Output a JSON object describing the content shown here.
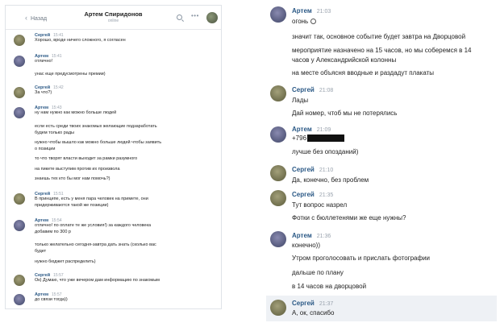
{
  "left": {
    "header": {
      "back": "Назад",
      "title": "Артем Спиридонов",
      "subtitle": "online"
    },
    "messages": [
      {
        "name": "Сергей",
        "time": "15:41",
        "lines": [
          "Хорошо, вроде ничего сложного, я согласен"
        ]
      },
      {
        "name": "Артем",
        "time": "15:41",
        "lines": [
          "отлично!"
        ]
      },
      {
        "name": "Сергей",
        "time": "15:42",
        "lines": [
          "За что?)"
        ]
      },
      {
        "name": "Артем",
        "time": "15:43",
        "lines": [
          "ну нам нужно как можно больше людей"
        ]
      },
      {
        "name": "Сергей",
        "time": "15:51",
        "lines": [
          "В принципе, есть у меня пара человек на примете, они",
          "придерживаются такой же позиции)"
        ]
      },
      {
        "name": "Артем",
        "time": "15:54",
        "lines": [
          "отлично! по оплате те же условия!) за каждого человека",
          "добавим по 300 р"
        ]
      },
      {
        "name": "Сергей",
        "time": "15:57",
        "lines": [
          "Ок) Думаю, что уже вечером дам информацию по знакомым"
        ]
      },
      {
        "name": "Артем",
        "time": "15:57",
        "lines": [
          "до связи тогда))"
        ]
      }
    ],
    "extra_lines": [
      "унас еще предусмотрены премии)",
      "если есть среди твоих знакомых желающие подзаработать",
      "будем только рады",
      "нужно чтобы вышло как можно больше людей чтобы заявить",
      "о позиции",
      "то что творят власти выходит за рамки разумного",
      "на пикете выступим против их произвола",
      "знаешь тех кто бы мог нам помочь?)",
      "только желательно сегодня-завтра дать знать (сколько вас",
      "будет",
      "нужно бюджет распределить)"
    ]
  },
  "right": {
    "messages": [
      {
        "name": "Артем",
        "time": "21:03",
        "lines": [
          "огонь"
        ]
      },
      {
        "name": "Сергей",
        "time": "21:08",
        "lines": [
          "Лады"
        ]
      },
      {
        "name": "Артем",
        "time": "21:09",
        "lines": [
          "+796"
        ]
      },
      {
        "name": "Сергей",
        "time": "21:10",
        "lines": [
          "Да, конечно, без проблем"
        ]
      },
      {
        "name": "Сергей",
        "time": "21:35",
        "lines": [
          "Тут вопрос назрел"
        ]
      },
      {
        "name": "Артем",
        "time": "21:36",
        "lines": [
          "конечно))"
        ]
      },
      {
        "name": "Сергей",
        "time": "21:37",
        "lines": [
          "А, ок, спасибо"
        ]
      }
    ],
    "extra_lines": [
      "значит так, основное событие будет завтра на Дворцовой",
      "мероприятие назначено на 15 часов, но мы соберемся в 14",
      "часов у Александрийской колонны",
      "на месте объясня вводные и раздадут плакаты",
      "Дай номер, чтоб мы не потерялись",
      "лучше без опозданий)",
      "Фотки с бюллетенями же еще нужны?",
      "Утром проголосовать и прислать фотографии",
      "дальше по плану",
      "в 14 часов на дворцовой"
    ]
  }
}
